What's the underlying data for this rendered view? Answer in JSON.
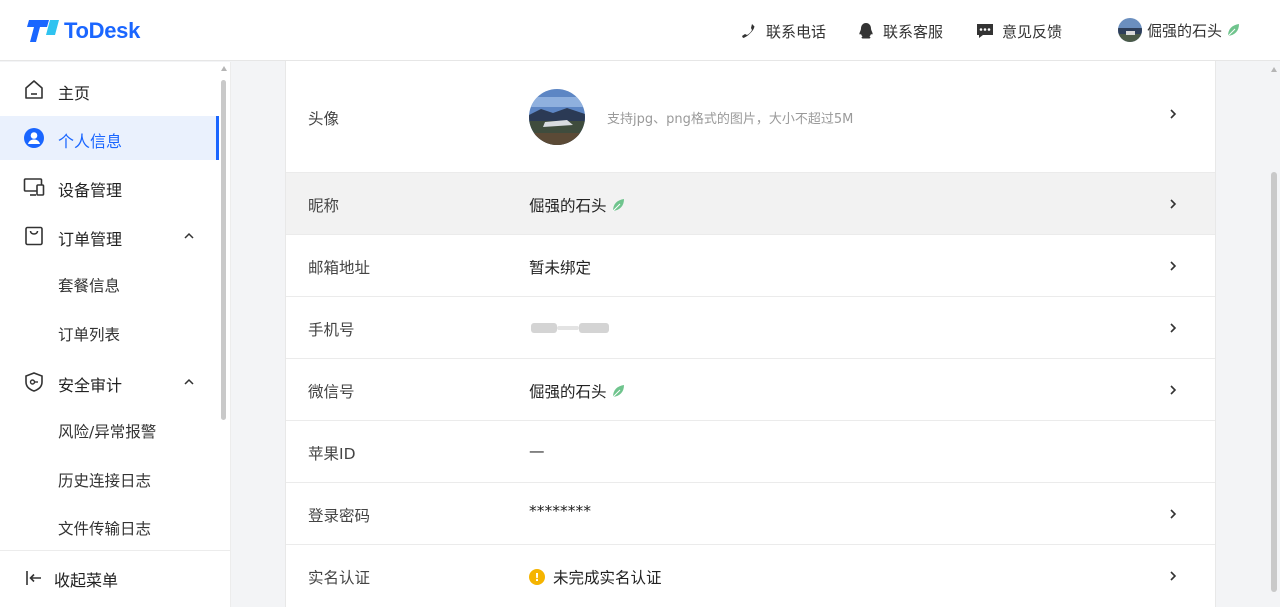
{
  "app": {
    "logo_text": "ToDesk",
    "brand_color": "#1a66ff"
  },
  "header": {
    "links": [
      {
        "label": "联系电话",
        "icon": "phone-icon"
      },
      {
        "label": "联系客服",
        "icon": "qq-icon"
      },
      {
        "label": "意见反馈",
        "icon": "feedback-icon"
      }
    ],
    "user_name": "倔强的石头"
  },
  "sidebar": {
    "items": [
      {
        "label": "主页",
        "icon": "home-icon"
      },
      {
        "label": "个人信息",
        "icon": "user-icon",
        "active": true
      },
      {
        "label": "设备管理",
        "icon": "devices-icon"
      },
      {
        "label": "订单管理",
        "icon": "bag-icon",
        "expanded": true
      },
      {
        "label": "套餐信息"
      },
      {
        "label": "订单列表"
      },
      {
        "label": "安全审计",
        "icon": "shield-icon",
        "expanded": true
      },
      {
        "label": "风险/异常报警"
      },
      {
        "label": "历史连接日志"
      },
      {
        "label": "文件传输日志"
      }
    ],
    "collapse_label": "收起菜单"
  },
  "profile": {
    "avatar_label": "头像",
    "avatar_hint": "支持jpg、png格式的图片，大小不超过5M",
    "rows": [
      {
        "label": "昵称",
        "value": "倔强的石头"
      },
      {
        "label": "邮箱地址",
        "value": "暂未绑定"
      },
      {
        "label": "手机号",
        "value": ""
      },
      {
        "label": "微信号",
        "value": "倔强的石头"
      },
      {
        "label": "苹果ID",
        "value": "—"
      },
      {
        "label": "登录密码",
        "value": "********"
      },
      {
        "label": "实名认证",
        "value": "未完成实名认证"
      }
    ]
  }
}
